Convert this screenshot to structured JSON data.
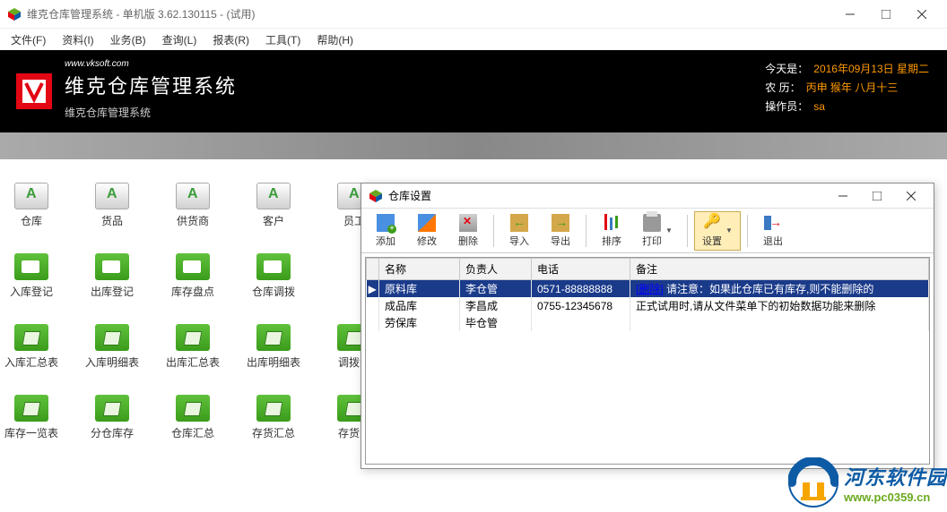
{
  "main_window": {
    "title": "维克仓库管理系统 - 单机版 3.62.130115 - (试用)"
  },
  "menu": {
    "items": [
      "文件(F)",
      "资料(I)",
      "业务(B)",
      "查询(L)",
      "报表(R)",
      "工具(T)",
      "帮助(H)"
    ]
  },
  "banner": {
    "url": "www.vksoft.com",
    "brand": "维克仓库管理系统",
    "sub": "维克仓库管理系统",
    "today_label": "今天是：",
    "today_value": "2016年09月13日  星期二",
    "lunar_label": "农   历：",
    "lunar_value": "丙申 猴年 八月十三",
    "operator_label": "操作员：",
    "operator_value": "sa"
  },
  "desktop": {
    "rows": [
      [
        {
          "label": "仓库",
          "icon": "xls"
        },
        {
          "label": "货品",
          "icon": "xls"
        },
        {
          "label": "供货商",
          "icon": "xls"
        },
        {
          "label": "客户",
          "icon": "xls"
        },
        {
          "label": "员工",
          "icon": "xls"
        }
      ],
      [
        {
          "label": "入库登记",
          "icon": "folder"
        },
        {
          "label": "出库登记",
          "icon": "folder"
        },
        {
          "label": "库存盘点",
          "icon": "folder"
        },
        {
          "label": "仓库调拨",
          "icon": "folder"
        }
      ],
      [
        {
          "label": "入库汇总表",
          "icon": "folder2"
        },
        {
          "label": "入库明细表",
          "icon": "folder2"
        },
        {
          "label": "出库汇总表",
          "icon": "folder2"
        },
        {
          "label": "出库明细表",
          "icon": "folder2"
        },
        {
          "label": "调拨明",
          "icon": "folder2"
        }
      ],
      [
        {
          "label": "库存一览表",
          "icon": "folder2"
        },
        {
          "label": "分仓库存",
          "icon": "folder2"
        },
        {
          "label": "仓库汇总",
          "icon": "folder2"
        },
        {
          "label": "存货汇总",
          "icon": "folder2"
        },
        {
          "label": "存货分",
          "icon": "folder2"
        }
      ]
    ]
  },
  "dialog": {
    "title": "仓库设置",
    "toolbar": {
      "add": "添加",
      "edit": "修改",
      "delete": "删除",
      "import": "导入",
      "export": "导出",
      "sort": "排序",
      "print": "打印",
      "settings": "设置",
      "exit": "退出"
    },
    "table": {
      "headers": [
        "",
        "名称",
        "负责人",
        "电话",
        "备注"
      ],
      "rows": [
        {
          "marker": "▶",
          "name": "原料库",
          "person": "李仓管",
          "phone": "0571-88888888",
          "note_del": "[删除]",
          "note": " 请注意：如果此仓库已有库存,则不能删除的",
          "selected": true
        },
        {
          "marker": "",
          "name": "成品库",
          "person": "李昌成",
          "phone": "0755-12345678",
          "note_del": "",
          "note": "正式试用时,请从文件菜单下的初始数据功能来删除",
          "selected": false
        },
        {
          "marker": "",
          "name": "劳保库",
          "person": "毕仓管",
          "phone": "",
          "note_del": "",
          "note": "",
          "selected": false
        }
      ]
    }
  },
  "watermark": {
    "cn": "河东软件园",
    "en": "www.pc0359.cn"
  }
}
